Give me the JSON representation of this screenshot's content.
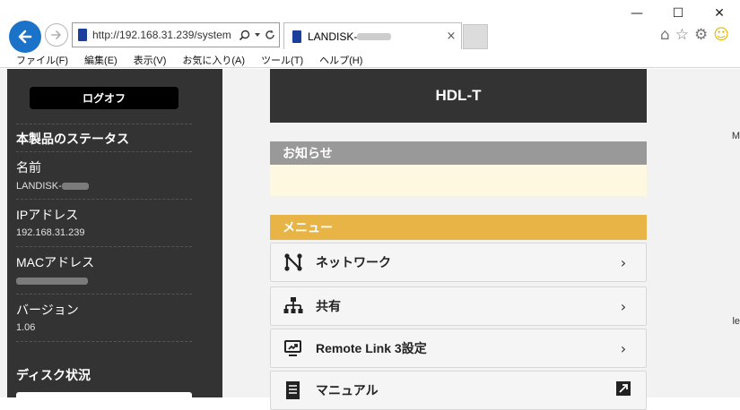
{
  "window": {
    "minimize_glyph": "—",
    "maximize_glyph": "☐",
    "close_glyph": "✕"
  },
  "browser": {
    "address": "http://192.168.31.239/system",
    "tab_title": "LANDISK-",
    "tab_close": "×",
    "menu": [
      "ファイル(F)",
      "編集(E)",
      "表示(V)",
      "お気に入り(A)",
      "ツール(T)",
      "ヘルプ(H)"
    ]
  },
  "sidebar": {
    "logout_label": "ログオフ",
    "status_heading": "本製品のステータス",
    "name_label": "名前",
    "name_value": "LANDISK-",
    "ip_label": "IPアドレス",
    "ip_value": "192.168.31.239",
    "mac_label": "MACアドレス",
    "version_label": "バージョン",
    "version_value": "1.06",
    "disk_heading": "ディスク状況"
  },
  "main": {
    "device_title": "HDL-T",
    "notice_heading": "お知らせ",
    "menu_heading": "メニュー",
    "menu_items": [
      {
        "label": "ネットワーク",
        "icon": "network-icon",
        "action": "›"
      },
      {
        "label": "共有",
        "icon": "share-tree-icon",
        "action": "›"
      },
      {
        "label": "Remote Link 3設定",
        "icon": "remote-link-icon",
        "action": "›"
      },
      {
        "label": "マニュアル",
        "icon": "manual-icon",
        "action": "⇗"
      }
    ],
    "edge_text_1": "M",
    "edge_text_2": "le"
  },
  "colors": {
    "sidebar_bg": "#333333",
    "menu_header": "#e8b445",
    "notice_header": "#999999",
    "notice_body": "#fff8e1",
    "back_button": "#1a73c8"
  }
}
